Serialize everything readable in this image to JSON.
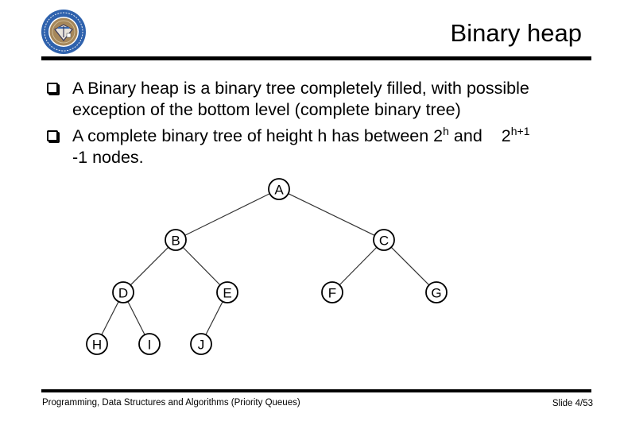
{
  "slide": {
    "title": "Binary heap",
    "logo_icon": "university-seal-logo",
    "bullets": [
      {
        "line1": "A Binary heap is a binary tree completely filled, with possible",
        "line2": "exception of the bottom level (complete binary tree)"
      },
      {
        "prefix": "A complete binary tree of height h has between 2",
        "sup1": "h",
        "middle": " and",
        "base2": "2",
        "sup2": "h+1",
        "line2": "-1 nodes."
      }
    ],
    "tree": {
      "nodes": [
        {
          "id": "A",
          "label": "A",
          "level": 0,
          "order": 0
        },
        {
          "id": "B",
          "label": "B",
          "level": 1,
          "order": 0
        },
        {
          "id": "C",
          "label": "C",
          "level": 1,
          "order": 1
        },
        {
          "id": "D",
          "label": "D",
          "level": 2,
          "order": 0
        },
        {
          "id": "E",
          "label": "E",
          "level": 2,
          "order": 1
        },
        {
          "id": "F",
          "label": "F",
          "level": 2,
          "order": 2
        },
        {
          "id": "G",
          "label": "G",
          "level": 2,
          "order": 3
        },
        {
          "id": "H",
          "label": "H",
          "level": 3,
          "order": 0
        },
        {
          "id": "I",
          "label": "I",
          "level": 3,
          "order": 1
        },
        {
          "id": "J",
          "label": "J",
          "level": 3,
          "order": 2
        }
      ],
      "edges": [
        [
          "A",
          "B"
        ],
        [
          "A",
          "C"
        ],
        [
          "B",
          "D"
        ],
        [
          "B",
          "E"
        ],
        [
          "C",
          "F"
        ],
        [
          "C",
          "G"
        ],
        [
          "D",
          "H"
        ],
        [
          "D",
          "I"
        ],
        [
          "E",
          "J"
        ]
      ]
    },
    "footer": {
      "course": "Programming, Data Structures and Algorithms  (Priority Queues)",
      "slide_number": "Slide 4/53"
    }
  }
}
